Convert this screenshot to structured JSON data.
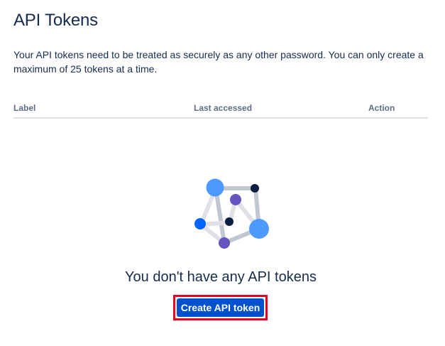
{
  "page": {
    "title": "API Tokens",
    "description": "Your API tokens need to be treated as securely as any other password. You can only create a maximum of 25 tokens at a time."
  },
  "table": {
    "columns": [
      "Label",
      "Last accessed",
      "Action"
    ]
  },
  "empty_state": {
    "illustration_icon": "network-nodes-icon",
    "message": "You don't have any API tokens",
    "button_label": "Create API token"
  },
  "colors": {
    "primary_button": "#0052cc",
    "highlight_border": "#e60023",
    "heading_text": "#172b4d",
    "muted_text": "#5e6c84"
  }
}
